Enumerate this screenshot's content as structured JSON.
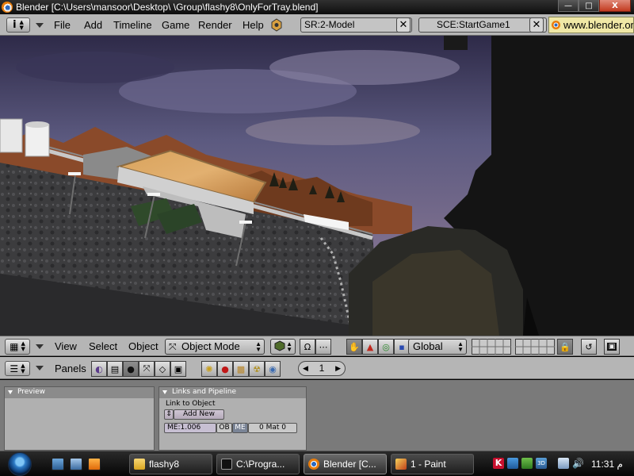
{
  "window": {
    "title": "Blender [C:\\Users\\mansoor\\Desktop\\  \\Group\\flashy8\\OnlyForTray.blend]",
    "controls": {
      "minimize": "—",
      "maximize": "□",
      "close": "X"
    }
  },
  "info_header": {
    "menus": [
      "File",
      "Add",
      "Timeline",
      "Game",
      "Render",
      "Help"
    ],
    "screen_field": "SR:2-Model",
    "scene_field": "SCE:StartGame1",
    "url": "www.blender.org"
  },
  "viewport_header": {
    "menus": [
      "View",
      "Select",
      "Object"
    ],
    "mode": "Object Mode",
    "orientation": "Global"
  },
  "buttons_header": {
    "panels_label": "Panels",
    "frame": "1"
  },
  "panels": {
    "preview": {
      "title": "Preview"
    },
    "links": {
      "title": "Links and Pipeline",
      "link_to_object": "Link to Object",
      "add_new": "Add New",
      "mesh_name": "ME:1.006",
      "ob_label": "OB",
      "me_label": "ME",
      "mat_count": "0 Mat 0"
    }
  },
  "taskbar": {
    "tasks": [
      "flashy8",
      "C:\\Progra...",
      "Blender [C...",
      "1 - Paint"
    ],
    "clock": "11:31 م"
  },
  "colors": {
    "accent_blender_orange": "#e87d0d",
    "header_gray": "#b7b7b7",
    "url_box": "#f0e8a6"
  }
}
